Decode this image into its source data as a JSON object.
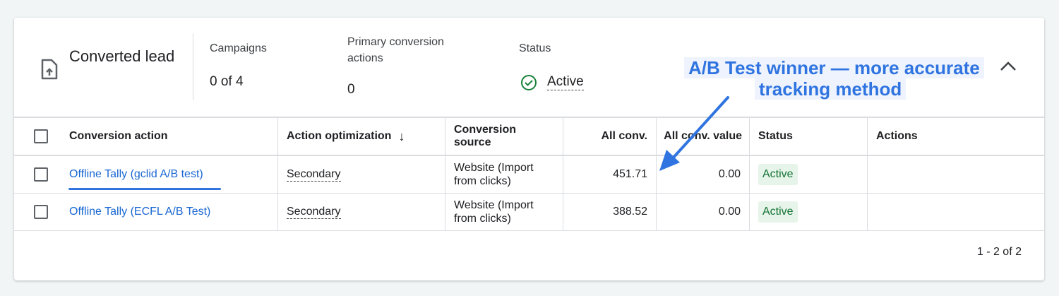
{
  "summary": {
    "title": "Converted lead",
    "icon": "file-upload-icon",
    "campaigns_label": "Campaigns",
    "campaigns_value": "0 of 4",
    "primary_label": "Primary conversion actions",
    "primary_value": "0",
    "status_label": "Status",
    "status_value": "Active"
  },
  "annotation": {
    "line1": "A/B Test winner — more accurate",
    "line2": "tracking method",
    "color": "#2f74e0"
  },
  "table": {
    "headers": [
      "Conversion action",
      "Action optimization",
      "Conversion source",
      "All conv.",
      "All conv. value",
      "Status",
      "Actions"
    ],
    "rows": [
      {
        "name": "Offline Tally (gclid A/B test)",
        "optimization": "Secondary",
        "source": "Website (Import from clicks)",
        "all_conv": "451.71",
        "value": "0.00",
        "status": "Active"
      },
      {
        "name": "Offline Tally (ECFL A/B Test)",
        "optimization": "Secondary",
        "source": "Website (Import from clicks)",
        "all_conv": "388.52",
        "value": "0.00",
        "status": "Active"
      }
    ]
  },
  "pagination": "1 - 2 of 2"
}
